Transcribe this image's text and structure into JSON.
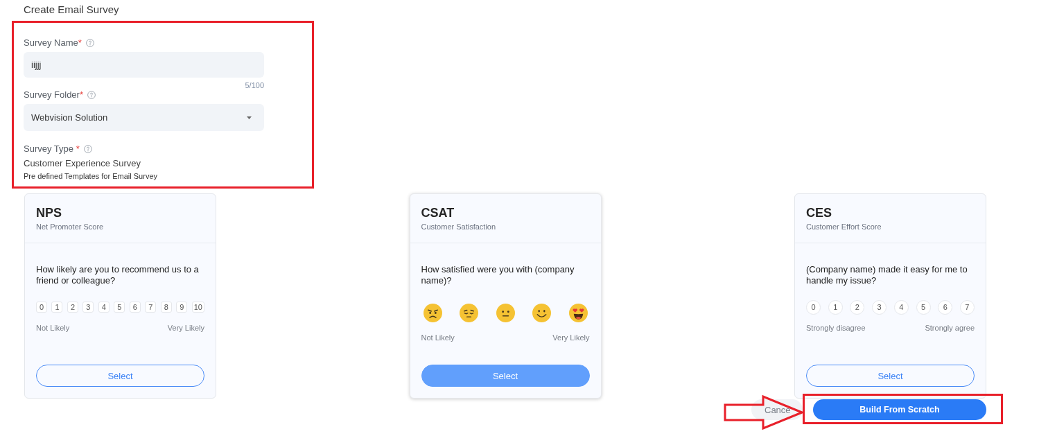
{
  "page": {
    "title": "Create Email Survey"
  },
  "form": {
    "highlighted": true,
    "fields": [
      {
        "kind": "text",
        "label": "Survey Name",
        "required_mark": "*",
        "value": "iijjj",
        "counter": "5/100"
      },
      {
        "kind": "select",
        "label": "Survey Folder",
        "required_mark": "*",
        "value": "Webvision Solution"
      },
      {
        "kind": "static",
        "label": "Survey Type",
        "required_mark": " *",
        "value": "Customer Experience Survey",
        "note": "Pre defined Templates for Email Survey"
      }
    ]
  },
  "templates": [
    {
      "kind": "boxes",
      "name": "NPS",
      "subtitle": "Net Promoter Score",
      "question": "How likely are you to recommend us to a friend or colleague?",
      "options": [
        "0",
        "1",
        "2",
        "3",
        "4",
        "5",
        "6",
        "7",
        "8",
        "9",
        "10"
      ],
      "low_label": "Not Likely",
      "high_label": "Very Likely",
      "button": "Select",
      "selected": false
    },
    {
      "kind": "emoji",
      "name": "CSAT",
      "subtitle": "Customer Satisfaction",
      "question": "How satisfied were you with (company name)?",
      "options": [
        {
          "kind": "angry"
        },
        {
          "kind": "pensive"
        },
        {
          "kind": "neutral"
        },
        {
          "kind": "smile"
        },
        {
          "kind": "heart_eyes"
        }
      ],
      "low_label": "Not Likely",
      "high_label": "Very Likely",
      "button": "Select",
      "selected": true
    },
    {
      "kind": "circles",
      "name": "CES",
      "subtitle": "Customer Effort Score",
      "question": "(Company name) made it easy for me to handle my issue?",
      "options": [
        "0",
        "1",
        "2",
        "3",
        "4",
        "5",
        "6",
        "7"
      ],
      "low_label": "Strongly disagree",
      "high_label": "Strongly agree",
      "button": "Select",
      "selected": false
    }
  ],
  "actions": {
    "arrow": true,
    "buttons": [
      {
        "kind": "cancel",
        "label": "Cance",
        "highlighted": false
      },
      {
        "kind": "build",
        "label": "Build From Scratch",
        "highlighted": true
      }
    ]
  }
}
